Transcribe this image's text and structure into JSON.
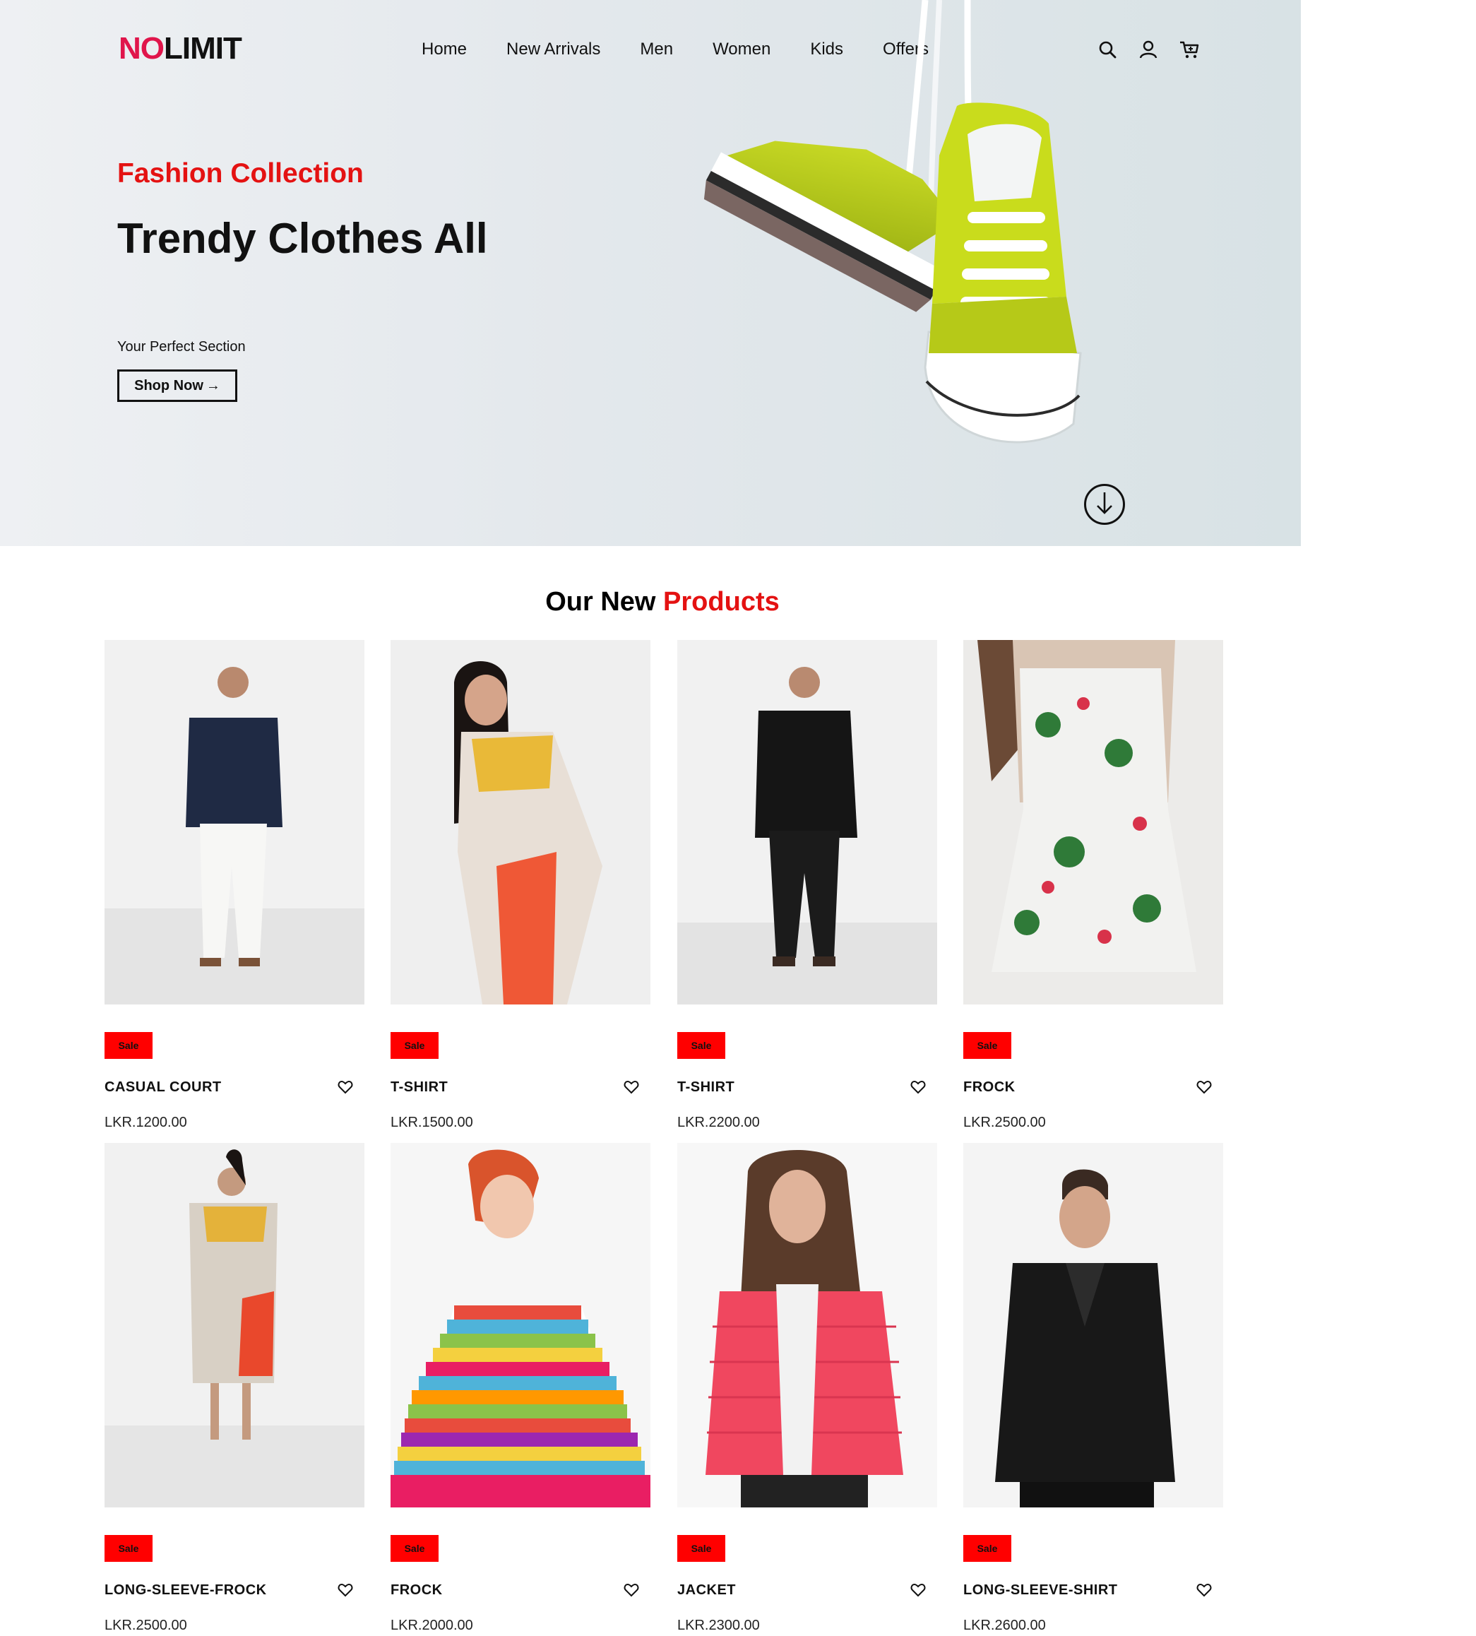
{
  "header": {
    "logo_part1": "NO",
    "logo_part2": "LIMIT",
    "nav": [
      "Home",
      "New Arrivals",
      "Men",
      "Women",
      "Kids",
      "Offers"
    ],
    "icons": [
      "search-icon",
      "user-icon",
      "cart-icon"
    ]
  },
  "hero": {
    "subtitle": "Fashion Collection",
    "title": "Trendy Clothes All",
    "tagline": "Your Perfect Section",
    "cta": "Shop Now",
    "cta_icon": "→"
  },
  "products_section": {
    "title_part1": "Our New ",
    "title_part2": "Products"
  },
  "products": [
    {
      "badge": "Sale",
      "name": "CASUAL COURT",
      "price": "LKR.1200.00"
    },
    {
      "badge": "Sale",
      "name": "T-SHIRT",
      "price": "LKR.1500.00"
    },
    {
      "badge": "Sale",
      "name": "T-SHIRT",
      "price": "LKR.2200.00"
    },
    {
      "badge": "Sale",
      "name": "FROCK",
      "price": "LKR.2500.00"
    },
    {
      "badge": "Sale",
      "name": "LONG-SLEEVE-FROCK",
      "price": "LKR.2500.00"
    },
    {
      "badge": "Sale",
      "name": "FROCK",
      "price": "LKR.2000.00"
    },
    {
      "badge": "Sale",
      "name": "JACKET",
      "price": "LKR.2300.00"
    },
    {
      "badge": "Sale",
      "name": "LONG-SLEEVE-SHIRT",
      "price": "LKR.2600.00"
    }
  ],
  "colors": {
    "brand_red": "#e0154b",
    "accent_red": "#e41212",
    "badge_red": "#ff0000",
    "sneaker_green": "#c3d81a"
  }
}
